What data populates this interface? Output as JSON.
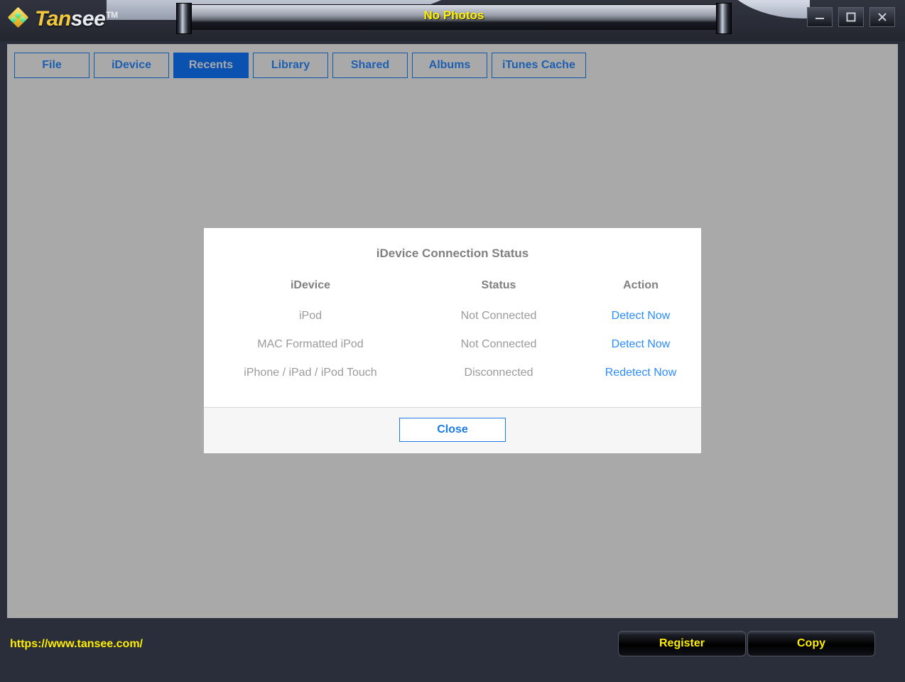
{
  "app": {
    "logo_tan": "Tan",
    "logo_see": "see",
    "logo_tm": "TM",
    "window_title": "No Photos"
  },
  "window_controls": [
    {
      "name": "minimize",
      "icon": "minimize-icon"
    },
    {
      "name": "maximize",
      "icon": "maximize-icon"
    },
    {
      "name": "close",
      "icon": "close-icon"
    }
  ],
  "tabs": [
    {
      "label": "File",
      "active": false
    },
    {
      "label": "iDevice",
      "active": false
    },
    {
      "label": "Recents",
      "active": true
    },
    {
      "label": "Library",
      "active": false
    },
    {
      "label": "Shared",
      "active": false
    },
    {
      "label": "Albums",
      "active": false
    },
    {
      "label": "iTunes Cache",
      "active": false
    }
  ],
  "dialog": {
    "title": "iDevice Connection Status",
    "columns": [
      "iDevice",
      "Status",
      "Action"
    ],
    "rows": [
      {
        "device": "iPod",
        "status": "Not Connected",
        "action": "Detect Now"
      },
      {
        "device": "MAC Formatted iPod",
        "status": "Not Connected",
        "action": "Detect Now"
      },
      {
        "device": "iPhone / iPad / iPod Touch",
        "status": "Disconnected",
        "action": "Redetect Now"
      }
    ],
    "close_label": "Close"
  },
  "footer": {
    "url": "https://www.tansee.com/",
    "register_label": "Register",
    "copy_label": "Copy"
  },
  "colors": {
    "accent_blue": "#1d5fb0",
    "active_tab_bg": "#0a51b0",
    "link_blue": "#2b8cff",
    "highlight_yellow": "#ffee00",
    "content_grey": "#a9a9a9",
    "chrome_dark": "#2a2d3a"
  }
}
